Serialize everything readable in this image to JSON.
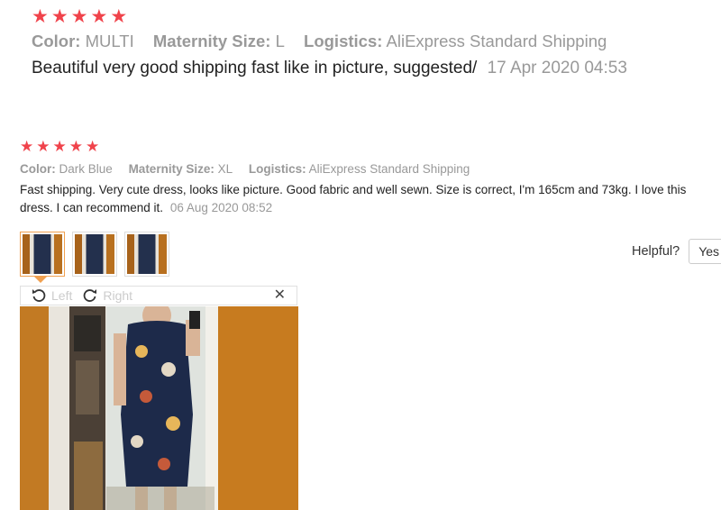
{
  "review1": {
    "stars": [
      "★",
      "★",
      "★",
      "★",
      "★"
    ],
    "color_label": "Color:",
    "color_value": "MULTI",
    "size_label": "Maternity Size:",
    "size_value": "L",
    "logistics_label": "Logistics:",
    "logistics_value": "AliExpress Standard Shipping",
    "text": "Beautiful very good shipping fast like in picture, suggested/",
    "date": "17 Apr 2020 04:53"
  },
  "review2": {
    "stars": [
      "★",
      "★",
      "★",
      "★",
      "★"
    ],
    "color_label": "Color:",
    "color_value": "Dark Blue",
    "size_label": "Maternity Size:",
    "size_value": "XL",
    "logistics_label": "Logistics:",
    "logistics_value": "AliExpress Standard Shipping",
    "text": "Fast shipping. Very cute dress, looks like picture. Good fabric and well sewn. Size is correct, I'm 165cm and 73kg. I love this dress. I can recommend it.",
    "date": "06 Aug 2020 08:52",
    "thumbnail_count": 3,
    "selected_thumbnail": 1
  },
  "viewer": {
    "rotate_left_label": "Left",
    "rotate_right_label": "Right",
    "close_label": "✕"
  },
  "helpful": {
    "label": "Helpful?",
    "yes_label": "Yes"
  },
  "colors": {
    "star": "#f0434b",
    "meta_text": "#999999",
    "thumbnail_active_border": "#f0a050"
  }
}
